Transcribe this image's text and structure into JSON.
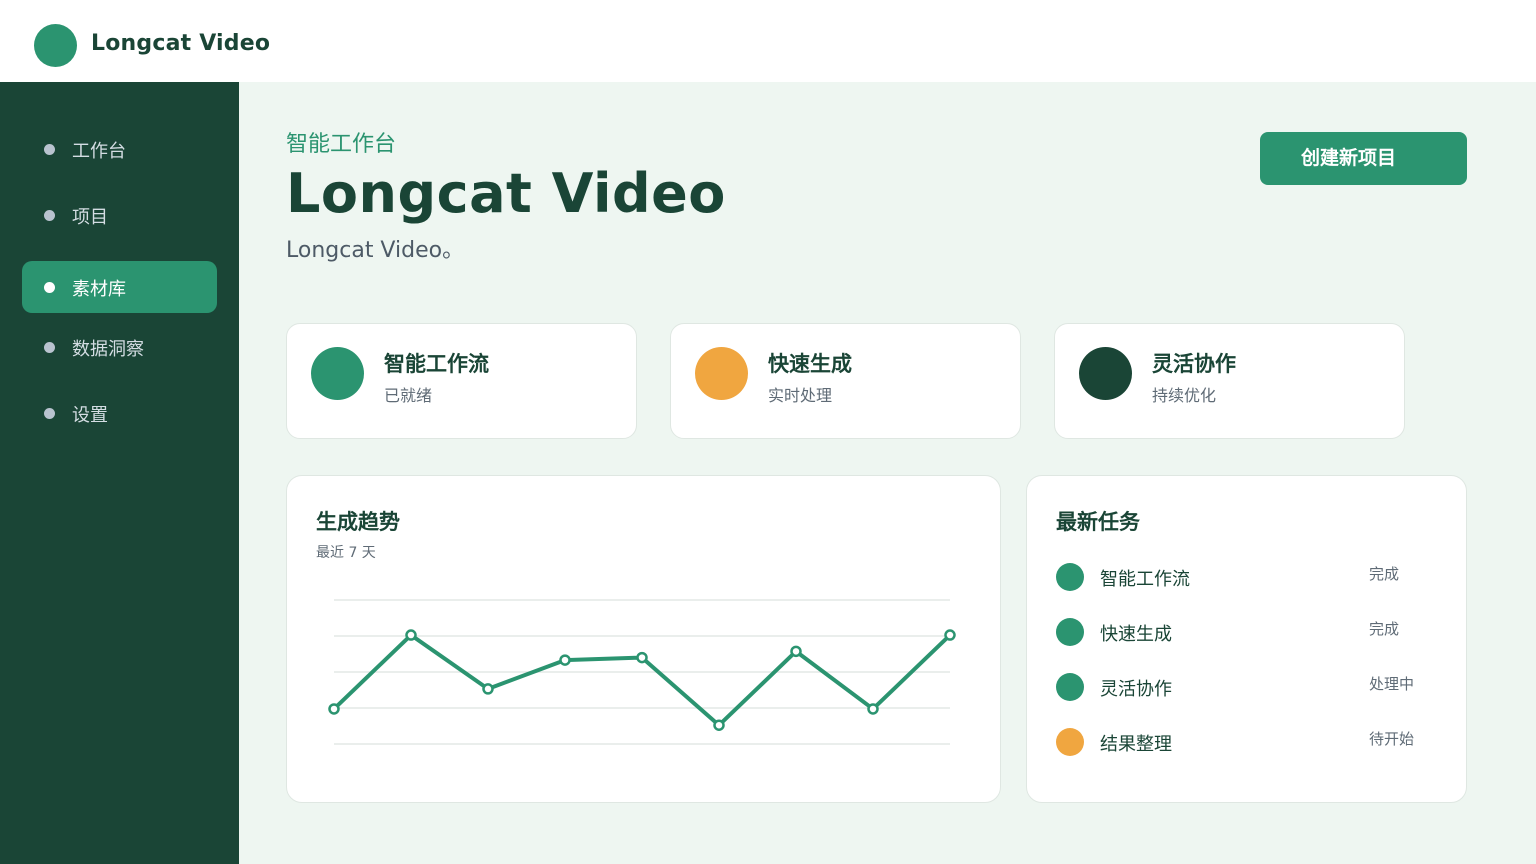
{
  "app": {
    "name": "Longcat Video"
  },
  "sidebar": {
    "items": [
      {
        "label": "工作台",
        "active": false
      },
      {
        "label": "项目",
        "active": false
      },
      {
        "label": "素材库",
        "active": true
      },
      {
        "label": "数据洞察",
        "active": false
      },
      {
        "label": "设置",
        "active": false
      }
    ]
  },
  "header": {
    "eyebrow": "智能工作台",
    "title": "Longcat Video",
    "subtitle": "Longcat Video。",
    "create_button": "创建新项目"
  },
  "stats": [
    {
      "title": "智能工作流",
      "subtitle": "已就绪",
      "color": "#2b9470"
    },
    {
      "title": "快速生成",
      "subtitle": "实时处理",
      "color": "#f0a640"
    },
    {
      "title": "灵活协作",
      "subtitle": "持续优化",
      "color": "#1a4536"
    }
  ],
  "trend": {
    "title": "生成趋势",
    "subtitle": "最近 7 天"
  },
  "chart_data": {
    "type": "line",
    "title": "生成趋势",
    "subtitle": "最近 7 天",
    "series": [
      {
        "values": [
          28,
          87,
          44,
          67,
          69,
          15,
          74,
          28,
          87
        ],
        "color": "#2b9470"
      }
    ],
    "ylim": [
      0,
      115
    ],
    "grid": true,
    "legend": "none"
  },
  "tasks": {
    "title": "最新任务",
    "items": [
      {
        "name": "智能工作流",
        "status": "完成",
        "color": "#2b9470"
      },
      {
        "name": "快速生成",
        "status": "完成",
        "color": "#2b9470"
      },
      {
        "name": "灵活协作",
        "status": "处理中",
        "color": "#2b9470"
      },
      {
        "name": "结果整理",
        "status": "待开始",
        "color": "#f0a640"
      }
    ]
  }
}
